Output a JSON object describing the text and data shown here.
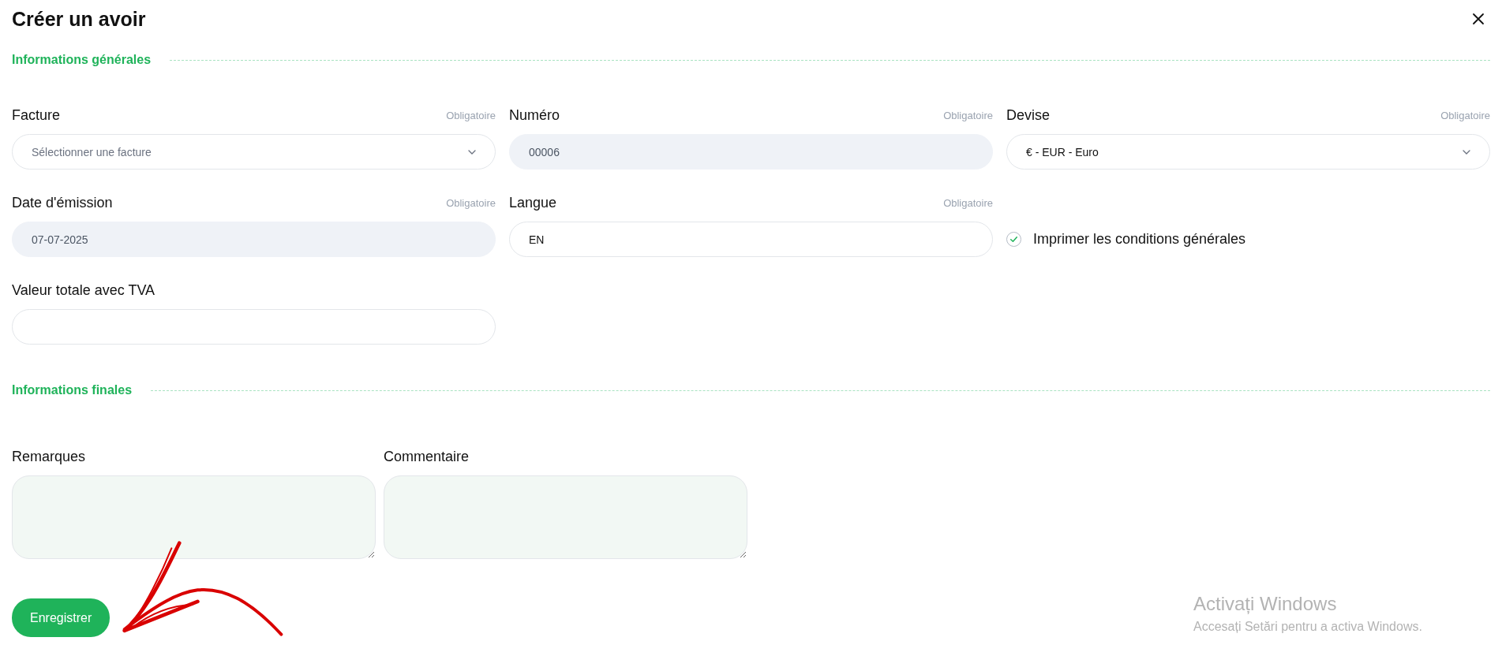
{
  "dialog": {
    "title": "Créer un avoir"
  },
  "sections": [
    {
      "heading": "Informations générales",
      "items": [
        {
          "kind": "select",
          "label": "Facture",
          "required": "Obligatoire",
          "placeholder": "Sélectionner une facture",
          "disabled": false
        },
        {
          "kind": "input",
          "label": "Numéro",
          "required": "Obligatoire",
          "value": "00006",
          "disabled": true
        },
        {
          "kind": "select",
          "label": "Devise",
          "required": "Obligatoire",
          "value": "€ - EUR - Euro",
          "disabled": false
        },
        {
          "kind": "input",
          "label": "Date d'émission",
          "required": "Obligatoire",
          "value": "07-07-2025",
          "disabled": true
        },
        {
          "kind": "input",
          "label": "Langue",
          "required": "Obligatoire",
          "value": "EN",
          "disabled": false
        },
        {
          "kind": "checkbox",
          "label": "Imprimer les conditions générales",
          "checked": true
        },
        {
          "kind": "input",
          "label": "Valeur totale avec TVA",
          "disabled": false
        }
      ]
    },
    {
      "heading": "Informations finales",
      "items": [
        {
          "kind": "textarea",
          "label": "Remarques"
        },
        {
          "kind": "textarea",
          "label": "Commentaire"
        }
      ]
    }
  ],
  "save_button": "Enregistrer",
  "annotation": {
    "kind": "arrow"
  },
  "os_notice": {
    "title": "Activați Windows",
    "text": "Accesați Setări pentru a activa Windows."
  }
}
